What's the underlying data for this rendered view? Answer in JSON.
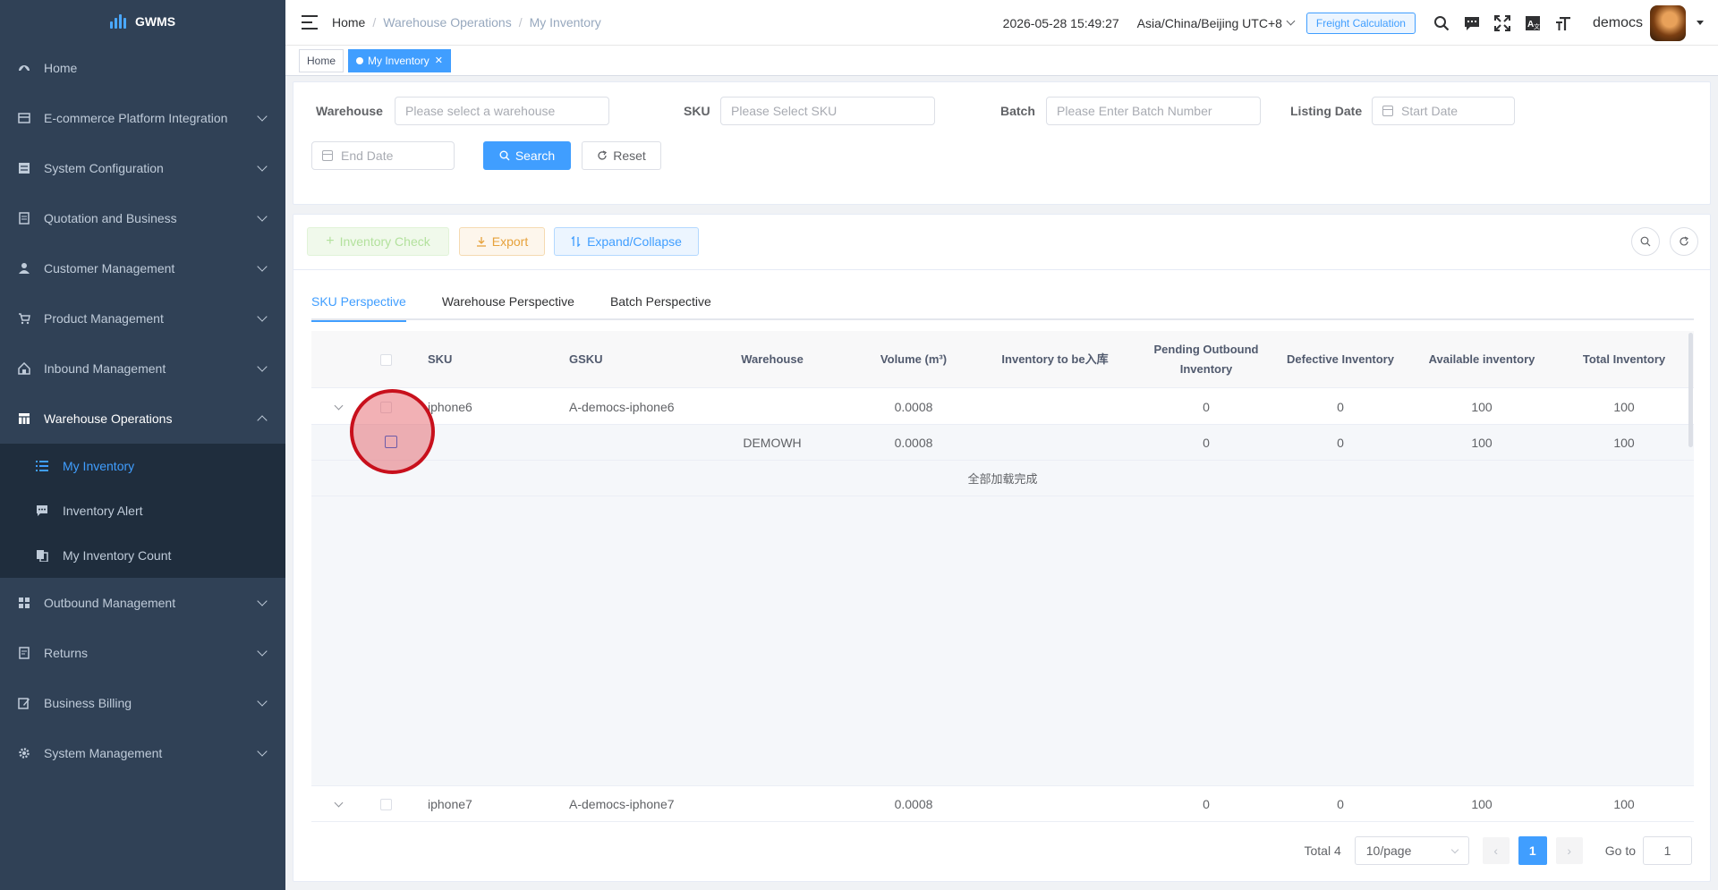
{
  "app": {
    "name": "GWMS"
  },
  "sidebar": {
    "items": [
      {
        "label": "Home",
        "icon": "dashboard-icon",
        "chevron": false
      },
      {
        "label": "E-commerce Platform Integration",
        "icon": "store-icon",
        "chevron": true
      },
      {
        "label": "System Configuration",
        "icon": "server-icon",
        "chevron": true
      },
      {
        "label": "Quotation and Business",
        "icon": "document-icon",
        "chevron": true
      },
      {
        "label": "Customer Management",
        "icon": "user-icon",
        "chevron": true
      },
      {
        "label": "Product Management",
        "icon": "cart-icon",
        "chevron": true
      },
      {
        "label": "Inbound Management",
        "icon": "house-icon",
        "chevron": true
      },
      {
        "label": "Warehouse Operations",
        "icon": "table-icon",
        "chevron": true,
        "open": true
      },
      {
        "label": "Outbound Management",
        "icon": "grid-icon",
        "chevron": true
      },
      {
        "label": "Returns",
        "icon": "return-icon",
        "chevron": true
      },
      {
        "label": "Business Billing",
        "icon": "edit-icon",
        "chevron": true
      },
      {
        "label": "System Management",
        "icon": "gear-icon",
        "chevron": true
      }
    ],
    "submenu": [
      {
        "label": "My Inventory",
        "icon": "list-icon",
        "active": true
      },
      {
        "label": "Inventory Alert",
        "icon": "message-icon",
        "active": false
      },
      {
        "label": "My Inventory Count",
        "icon": "copy-icon",
        "active": false
      }
    ]
  },
  "header": {
    "breadcrumb": [
      "Home",
      "Warehouse Operations",
      "My Inventory"
    ],
    "datetime": "2026-05-28 15:49:27",
    "timezone": "Asia/China/Beijing UTC+8",
    "freight_label": "Freight Calculation",
    "username": "democs"
  },
  "tags_view": {
    "tags": [
      {
        "label": "Home",
        "active": false
      },
      {
        "label": "My Inventory",
        "active": true
      }
    ]
  },
  "search_form": {
    "warehouse_label": "Warehouse",
    "warehouse_placeholder": "Please select a warehouse",
    "sku_label": "SKU",
    "sku_placeholder": "Please Select SKU",
    "batch_label": "Batch",
    "batch_placeholder": "Please Enter Batch Number",
    "listing_date_label": "Listing Date",
    "start_date_placeholder": "Start Date",
    "end_date_placeholder": "End Date",
    "search_label": "Search",
    "reset_label": "Reset"
  },
  "toolbar": {
    "inventory_check_label": "Inventory Check",
    "export_label": "Export",
    "expand_collapse_label": "Expand/Collapse"
  },
  "tabs": [
    {
      "label": "SKU Perspective",
      "active": true
    },
    {
      "label": "Warehouse Perspective",
      "active": false
    },
    {
      "label": "Batch Perspective",
      "active": false
    }
  ],
  "table": {
    "columns": {
      "sku": "SKU",
      "gsku": "GSKU",
      "warehouse": "Warehouse",
      "volume": "Volume (m³)",
      "to_inbound": "Inventory to be入库",
      "pending_outbound": "Pending Outbound Inventory",
      "defective": "Defective Inventory",
      "available": "Available inventory",
      "total": "Total Inventory"
    },
    "rows": [
      {
        "sku": "iphone6",
        "gsku": "A-democs-iphone6",
        "warehouse": "",
        "volume": "0.0008",
        "to_inbound": "",
        "pending_outbound": "0",
        "defective": "0",
        "available": "100",
        "total": "100"
      },
      {
        "sku": "",
        "gsku": "",
        "warehouse": "DEMOWH",
        "volume": "0.0008",
        "to_inbound": "",
        "pending_outbound": "0",
        "defective": "0",
        "available": "100",
        "total": "100"
      },
      {
        "sku": "iphone7",
        "gsku": "A-democs-iphone7",
        "warehouse": "",
        "volume": "0.0008",
        "to_inbound": "",
        "pending_outbound": "0",
        "defective": "0",
        "available": "100",
        "total": "100"
      }
    ],
    "loaded_message": "全部加载完成"
  },
  "pagination": {
    "total_text": "Total 4",
    "page_size": "10/page",
    "current_page": "1",
    "goto_label": "Go to",
    "goto_value": "1"
  },
  "colors": {
    "primary": "#409eff",
    "sidebar_bg": "#304156",
    "submenu_bg": "#1f2d3d",
    "highlight": "#c8101c"
  }
}
